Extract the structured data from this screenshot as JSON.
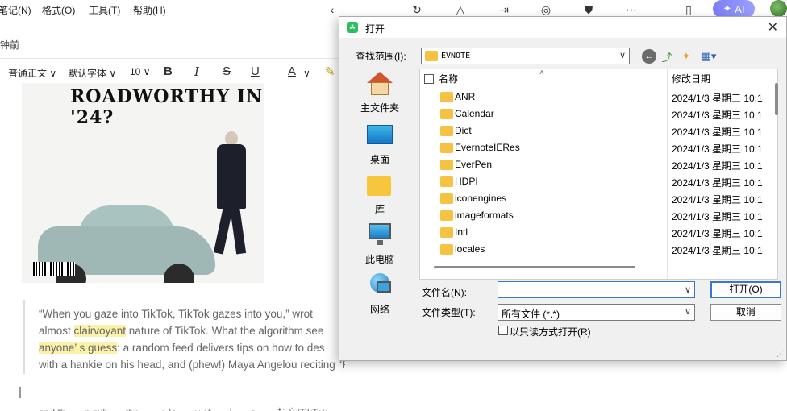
{
  "menubar": {
    "items": [
      "笔记(N)",
      "格式(O)",
      "工具(T)",
      "帮助(H)"
    ],
    "ai_label": "AI"
  },
  "editor": {
    "save_time": "钟前",
    "toolbar": {
      "paragraph_style": "普通正文",
      "font_family": "默认字体",
      "font_size": "10",
      "bold": "B",
      "italic": "I",
      "strike": "S",
      "underline": "U",
      "font_color": "A"
    },
    "image_headline": "ROADWORTHY IN '24?",
    "quote_lines": [
      {
        "segments": [
          {
            "text": "“When you gaze into TikTok, TikTok gazes into you,”  wrot",
            "hl": false
          }
        ]
      },
      {
        "segments": [
          {
            "text": "almost ",
            "hl": false
          },
          {
            "text": "clairvoyant",
            "hl": true
          },
          {
            "text": " nature of TikTok. What the algorithm see",
            "hl": false
          }
        ]
      },
      {
        "segments": [
          {
            "text": "anyone’ s guess",
            "hl": true
          },
          {
            "text": ": a random feed delivers tips on how to des",
            "hl": false
          }
        ]
      },
      {
        "segments": [
          {
            "text": "with a hankie on his head, and (phew!) Maya Angelou reciting “Phenomenal Woman” .",
            "hl": false
          }
        ]
      }
    ],
    "faded_line": "and th... ...n mill... ...the ... ...e la... ...y of... ...l... ...a... ... 抖音/TikTok..."
  },
  "dialog": {
    "title": "打开",
    "look_in_label": "查找范围(I):",
    "look_in_value": "EVNOTE",
    "places": [
      {
        "icon": "home-icon",
        "label": "主文件夹"
      },
      {
        "icon": "desktop-icon",
        "label": "桌面"
      },
      {
        "icon": "library-icon",
        "label": "库"
      },
      {
        "icon": "computer-icon",
        "label": "此电脑"
      },
      {
        "icon": "network-icon",
        "label": "网络"
      }
    ],
    "columns": {
      "name": "名称",
      "modified": "修改日期"
    },
    "files": [
      {
        "name": "ANR",
        "date": "2024/1/3 星期三 10:1"
      },
      {
        "name": "Calendar",
        "date": "2024/1/3 星期三 10:1"
      },
      {
        "name": "Dict",
        "date": "2024/1/3 星期三 10:1"
      },
      {
        "name": "EvernoteIERes",
        "date": "2024/1/3 星期三 10:1"
      },
      {
        "name": "EverPen",
        "date": "2024/1/3 星期三 10:1"
      },
      {
        "name": "HDPI",
        "date": "2024/1/3 星期三 10:1"
      },
      {
        "name": "iconengines",
        "date": "2024/1/3 星期三 10:1"
      },
      {
        "name": "imageformats",
        "date": "2024/1/3 星期三 10:1"
      },
      {
        "name": "Intl",
        "date": "2024/1/3 星期三 10:1"
      },
      {
        "name": "locales",
        "date": "2024/1/3 星期三 10:1"
      }
    ],
    "filename_label": "文件名(N):",
    "filename_value": "",
    "filetype_label": "文件类型(T):",
    "filetype_value": "所有文件 (*.*)",
    "readonly_label": "以只读方式打开(R)",
    "open_button": "打开(O)",
    "cancel_button": "取消"
  },
  "colors": {
    "accent": "#3a78c9",
    "folder": "#f5c242",
    "highlight": "#fbf1a9",
    "ai_pill": "#8a8ff8"
  }
}
